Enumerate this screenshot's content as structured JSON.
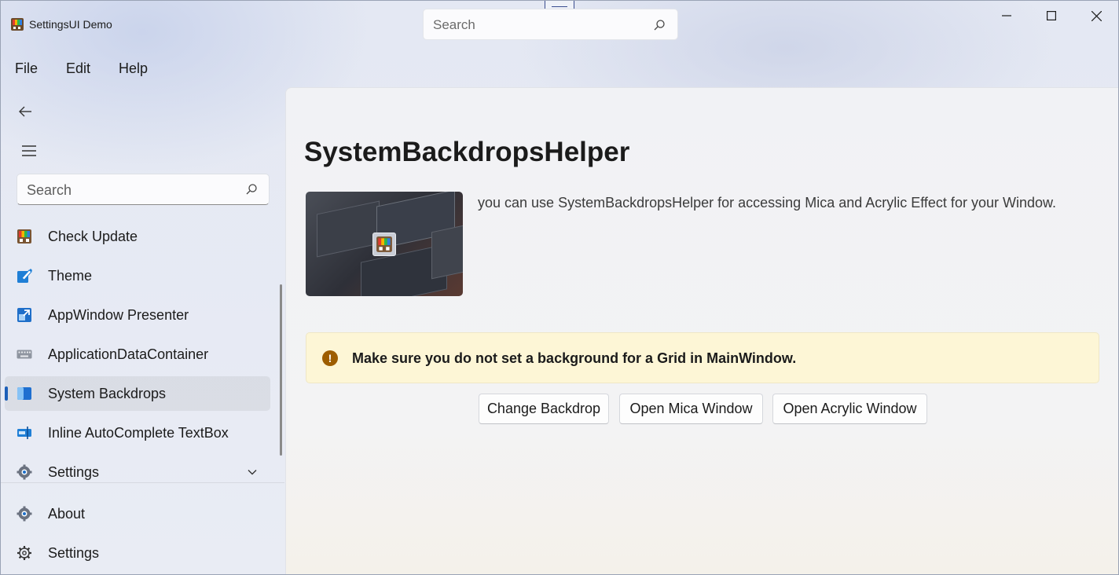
{
  "window": {
    "title": "SettingsUI Demo",
    "controls": [
      "minimize-icon",
      "maximize-icon",
      "close-icon"
    ]
  },
  "title_search": {
    "placeholder": "Search",
    "icon": "search-icon"
  },
  "menubar": {
    "items": [
      "File",
      "Edit",
      "Help"
    ]
  },
  "nav": {
    "search_placeholder": "Search",
    "items": [
      {
        "label": "Check Update",
        "icon": "check-update-icon",
        "selected": false
      },
      {
        "label": "Theme",
        "icon": "theme-icon",
        "selected": false
      },
      {
        "label": "AppWindow Presenter",
        "icon": "app-window-icon",
        "selected": false
      },
      {
        "label": "ApplicationDataContainer",
        "icon": "keyboard-icon",
        "selected": false
      },
      {
        "label": "System Backdrops",
        "icon": "backdrop-icon",
        "selected": true
      },
      {
        "label": "Inline AutoComplete TextBox",
        "icon": "textbox-icon",
        "selected": false
      },
      {
        "label": "Settings",
        "icon": "gear-icon",
        "selected": false,
        "expandable": true
      }
    ],
    "footer": [
      {
        "label": "About",
        "icon": "gear-icon"
      },
      {
        "label": "Settings",
        "icon": "gear-icon"
      }
    ]
  },
  "content": {
    "title": "SystemBackdropsHelper",
    "description": "you can use SystemBackdropsHelper for accessing Mica and Acrylic Effect for your Window.",
    "infobar": {
      "severity": "warning",
      "message": "Make sure you do not set a background for a Grid in MainWindow."
    },
    "buttons": [
      "Change Backdrop",
      "Open Mica Window",
      "Open Acrylic Window"
    ]
  },
  "colors": {
    "accent": "#1d5fb8",
    "warning_bg": "#fdf6d6",
    "warning_icon": "#9d5d00"
  }
}
